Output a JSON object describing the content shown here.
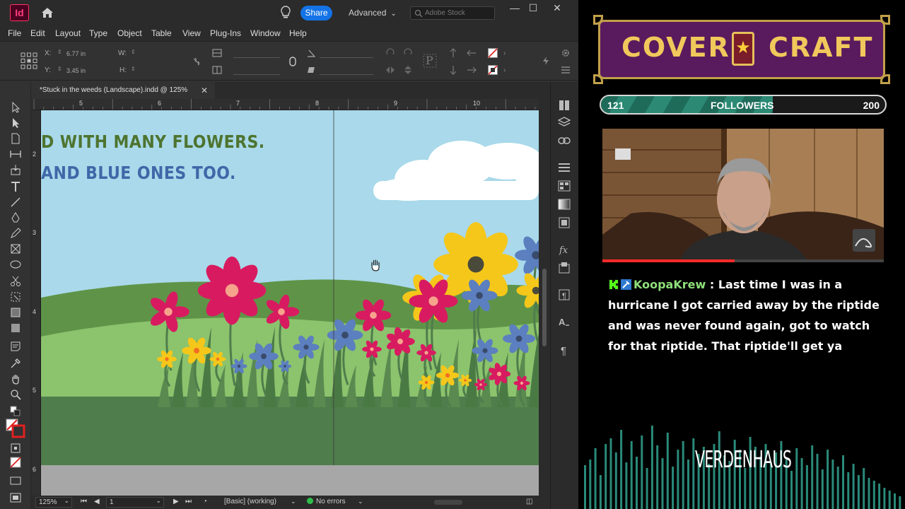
{
  "indesign": {
    "app_logo": "Id",
    "share_label": "Share",
    "workspace_label": "Advanced",
    "stock_placeholder": "Adobe Stock",
    "window_controls": [
      "—",
      "☐",
      "✕"
    ],
    "menu": [
      "File",
      "Edit",
      "Layout",
      "Type",
      "Object",
      "Table",
      "View",
      "Plug-Ins",
      "Window",
      "Help"
    ],
    "control": {
      "x_label": "X:",
      "x_value": "6.77 in",
      "y_label": "Y:",
      "y_value": "3.45 in",
      "w_label": "W:",
      "h_label": "H:"
    },
    "document_tab": "*Stuck in the weeds (Landscape).indd @ 125%",
    "tab_close": "✕",
    "ruler_h": [
      "5",
      "6",
      "7",
      "8",
      "9",
      "10"
    ],
    "ruler_v": [
      "2",
      "3",
      "4",
      "5",
      "6"
    ],
    "page_text": {
      "line1": "D WITH MANY FLOWERS.",
      "line2": "AND BLUE ONES TOO."
    },
    "status": {
      "zoom": "125%",
      "page": "1",
      "style": "[Basic] (working)",
      "errors": "No errors"
    },
    "colors": {
      "sky": "#a9d9ea",
      "hill_far": "#5f9448",
      "hill_near": "#8cc36d",
      "ground": "#4f7d4c",
      "pasteboard": "#a7a7a7"
    }
  },
  "overlay": {
    "brand_left": "COVER",
    "brand_star": "★",
    "brand_right": "CRAFT",
    "followers": {
      "current": "121",
      "label": "FOLLOWERS",
      "goal": "200",
      "progress": 0.605
    },
    "webcam_progress": 0.47,
    "chat": {
      "username": "KoopaKrew",
      "separator": " : ",
      "message": "Last time I was in a hurricane I got carried away by the riptide and was never found again, got to watch for that riptide. That riptide'll get ya"
    },
    "footer_brand": "VERDENHAUS",
    "colors": {
      "brand_bg": "#5a1a5e",
      "brand_gold": "#f0c85b",
      "followers_fill": "#2c8a74",
      "username": "#8fe07a",
      "visualizer": "#2a8a7a"
    }
  }
}
